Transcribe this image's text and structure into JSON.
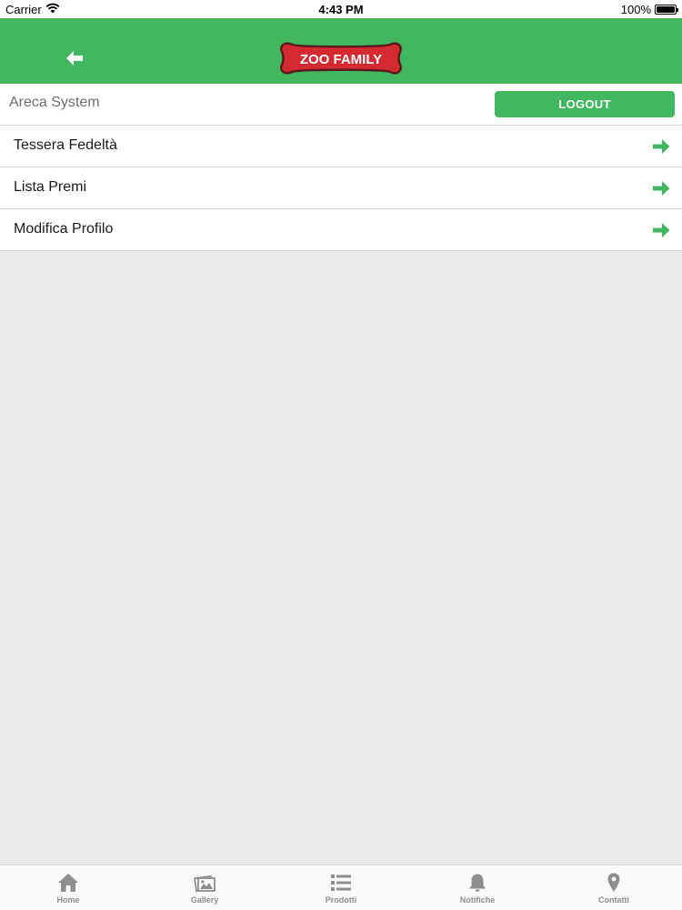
{
  "status_bar": {
    "carrier": "Carrier",
    "time": "4:43 PM",
    "battery": "100%"
  },
  "header": {
    "logo_text": "ZOO FAMILY",
    "back_icon": "back-arrow-icon",
    "colors": {
      "bar": "#41b860",
      "logo_bone": "#d42a31",
      "logo_outline": "#5a1a1a"
    }
  },
  "user": {
    "name": "Areca System",
    "logout_label": "LOGOUT"
  },
  "menu": {
    "items": [
      {
        "label": "Tessera Fedeltà",
        "icon": "arrow-right-icon"
      },
      {
        "label": "Lista Premi",
        "icon": "arrow-right-icon"
      },
      {
        "label": "Modifica Profilo",
        "icon": "arrow-right-icon"
      }
    ]
  },
  "tabs": {
    "items": [
      {
        "label": "Home",
        "icon": "home-icon"
      },
      {
        "label": "Gallery",
        "icon": "gallery-icon"
      },
      {
        "label": "Prodotti",
        "icon": "list-icon"
      },
      {
        "label": "Notifiche",
        "icon": "bell-icon"
      },
      {
        "label": "Contatti",
        "icon": "map-pin-icon"
      }
    ]
  },
  "colors": {
    "accent": "#41b860",
    "background": "#e9ebed",
    "tab_inactive": "#8e8e8e"
  }
}
